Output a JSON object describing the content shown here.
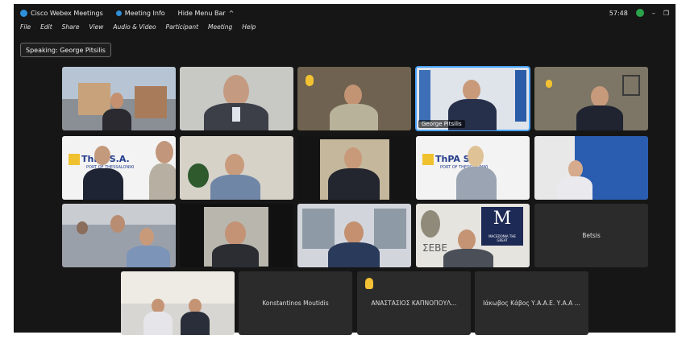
{
  "titlebar": {
    "app_name": "Cisco Webex Meetings",
    "meeting_info": "Meeting Info",
    "hide_menu_bar": "Hide Menu Bar",
    "time": "57:48",
    "minimize": "–",
    "restore": "❐"
  },
  "menu": [
    "File",
    "Edit",
    "Share",
    "View",
    "Audio & Video",
    "Participant",
    "Meeting",
    "Help"
  ],
  "speaking": "Speaking: George Pitsilis",
  "tiles": [
    {
      "label": ""
    },
    {
      "label": ""
    },
    {
      "label": ""
    },
    {
      "label": "George Pitsilis"
    },
    {
      "label": ""
    },
    {
      "label": "ThPA S.A.",
      "sub": "PORT OF THESSALONIKI"
    },
    {
      "label": ""
    },
    {
      "label": ""
    },
    {
      "label": "ThPA S.A.",
      "sub": "PORT OF THESSALONIKI"
    },
    {
      "label": ""
    },
    {
      "label": ""
    },
    {
      "label": ""
    },
    {
      "label": ""
    },
    {
      "label": "ΣΕΒΕ",
      "mac": "M",
      "mac_sub": "MACEDONIA THE GREAT"
    },
    {
      "label": "Betsis"
    },
    {
      "label": ""
    },
    {
      "label": "Konstantinos Moutidis"
    },
    {
      "label": "ΑΝΑΣΤΑΣΙΟΣ ΚΑΠΝΟΠΟΥΛ..."
    },
    {
      "label": "Ιάκωβος Κάβος Υ.Α.Α.Ε. Υ.Α.Α ..."
    }
  ]
}
